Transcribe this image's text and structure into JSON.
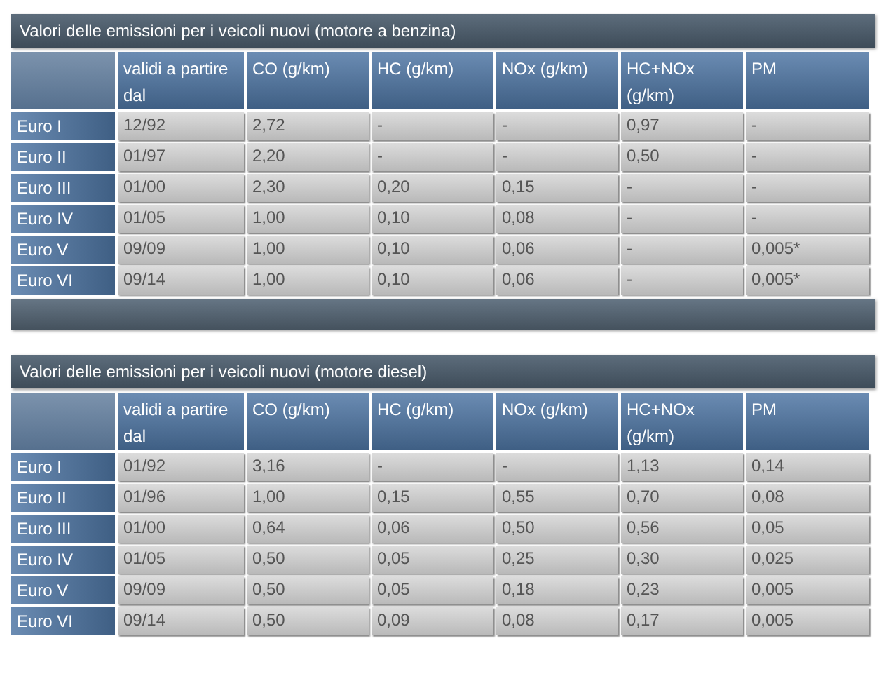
{
  "tables": [
    {
      "title": "Valori delle emissioni per i veicoli nuovi (motore a benzina)",
      "columns": [
        "validi a partire dal",
        "CO (g/km)",
        "HC (g/km)",
        "NOx (g/km)",
        "HC+NOx (g/km)",
        "PM"
      ],
      "rows": [
        {
          "label": "Euro I",
          "cells": [
            "12/92",
            "2,72",
            "-",
            "-",
            "0,97",
            "-"
          ]
        },
        {
          "label": "Euro II",
          "cells": [
            "01/97",
            "2,20",
            "-",
            "-",
            "0,50",
            "-"
          ]
        },
        {
          "label": "Euro III",
          "cells": [
            "01/00",
            "2,30",
            "0,20",
            "0,15",
            "-",
            "-"
          ]
        },
        {
          "label": "Euro IV",
          "cells": [
            "01/05",
            "1,00",
            "0,10",
            "0,08",
            "-",
            "-"
          ]
        },
        {
          "label": "Euro V",
          "cells": [
            "09/09",
            "1,00",
            "0,10",
            "0,06",
            "-",
            "0,005*"
          ]
        },
        {
          "label": "Euro VI",
          "cells": [
            "09/14",
            "1,00",
            "0,10",
            "0,06",
            "-",
            "0,005*"
          ]
        }
      ],
      "footer_bar": true
    },
    {
      "title": "Valori delle emissioni per i veicoli nuovi (motore diesel)",
      "columns": [
        "validi a partire dal",
        "CO (g/km)",
        "HC (g/km)",
        "NOx (g/km)",
        "HC+NOx (g/km)",
        "PM"
      ],
      "rows": [
        {
          "label": "Euro I",
          "cells": [
            "01/92",
            "3,16",
            "-",
            "-",
            "1,13",
            "0,14"
          ]
        },
        {
          "label": "Euro II",
          "cells": [
            "01/96",
            "1,00",
            "0,15",
            "0,55",
            "0,70",
            "0,08"
          ]
        },
        {
          "label": "Euro III",
          "cells": [
            "01/00",
            "0,64",
            "0,06",
            "0,50",
            "0,56",
            "0,05"
          ]
        },
        {
          "label": "Euro IV",
          "cells": [
            "01/05",
            "0,50",
            "0,05",
            "0,25",
            "0,30",
            "0,025"
          ]
        },
        {
          "label": "Euro V",
          "cells": [
            "09/09",
            "0,50",
            "0,05",
            "0,18",
            "0,23",
            "0,005"
          ]
        },
        {
          "label": "Euro VI",
          "cells": [
            "09/14",
            "0,50",
            "0,09",
            "0,08",
            "0,17",
            "0,005"
          ]
        }
      ],
      "footer_bar": false
    }
  ]
}
